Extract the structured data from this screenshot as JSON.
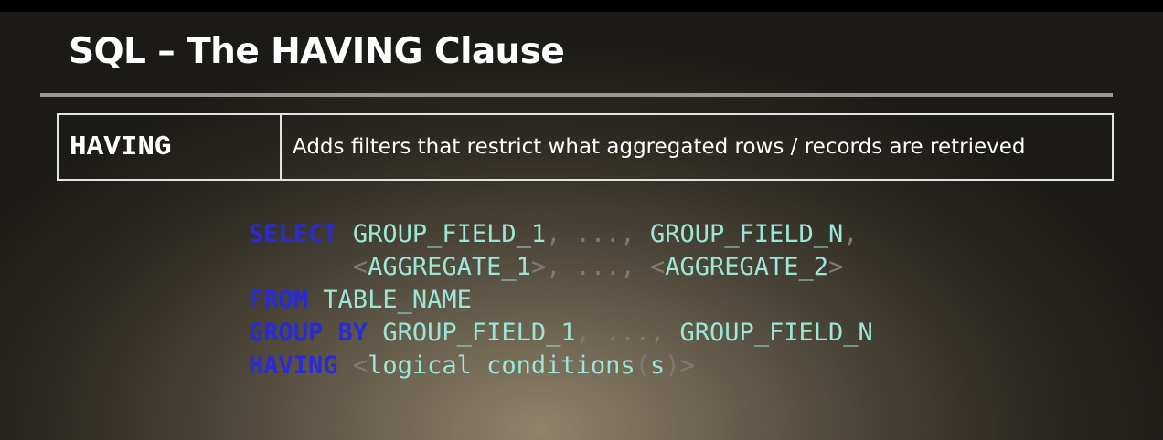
{
  "slide": {
    "title": "SQL – The HAVING Clause"
  },
  "definition": {
    "term": "HAVING",
    "description": "Adds filters that restrict what aggregated rows / records are retrieved"
  },
  "code": {
    "line1": {
      "kw": "SELECT",
      "gap": " ",
      "field1": "GROUP_FIELD_1",
      "sep1": ", ..., ",
      "field2": "GROUP_FIELD_N",
      "sep2": ","
    },
    "line2": {
      "indent": "       ",
      "lt1": "<",
      "agg1": "AGGREGATE_1",
      "sep": ">, ..., <",
      "agg2": "AGGREGATE_2",
      "gt2": ">"
    },
    "line3": {
      "kw": "FROM",
      "gap": " ",
      "table": "TABLE_NAME"
    },
    "line4": {
      "kw": "GROUP BY",
      "gap": " ",
      "field1": "GROUP_FIELD_1",
      "sep": ", ..., ",
      "field2": "GROUP_FIELD_N"
    },
    "line5": {
      "kw": "HAVING",
      "gap": " ",
      "lt": "<",
      "text1": "logical conditions",
      "paren_open": "(",
      "text2": "s",
      "paren_close": ")",
      "gt": ">"
    }
  },
  "colors": {
    "keyword": "#2a2ad6",
    "identifier": "#9be6d7",
    "punctuation": "#7e7a70",
    "title": "#ffffff"
  }
}
